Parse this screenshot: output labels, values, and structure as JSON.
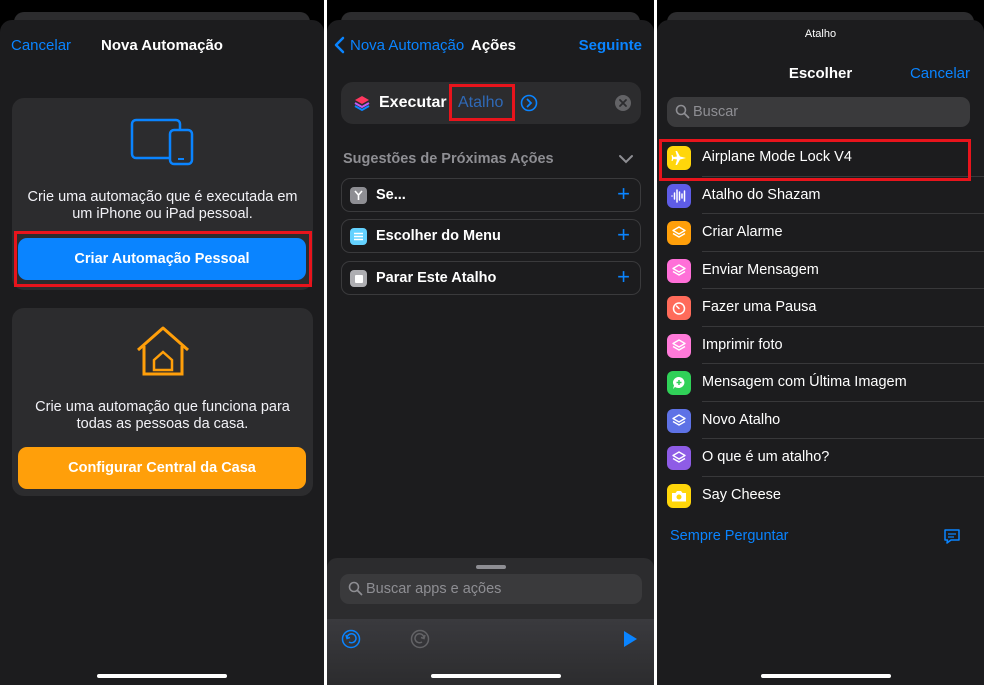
{
  "panel1": {
    "nav": {
      "cancel": "Cancelar",
      "title": "Nova Automação"
    },
    "personal": {
      "description_line1": "Crie uma automação que é executada em",
      "description_line2": "um iPhone ou iPad pessoal.",
      "button": "Criar Automação Pessoal"
    },
    "home": {
      "description_line1": "Crie uma automação que funciona para",
      "description_line2": "todas as pessoas da casa.",
      "button": "Configurar Central da Casa"
    }
  },
  "panel2": {
    "nav": {
      "back": "Nova Automação",
      "title": "Ações",
      "next": "Seguinte"
    },
    "action": {
      "verb": "Executar",
      "param": "Atalho"
    },
    "suggestions_header": "Sugestões de Próximas Ações",
    "suggestions": [
      {
        "label": "Se...",
        "icon": "branch-icon"
      },
      {
        "label": "Escolher do Menu",
        "icon": "menu-icon"
      },
      {
        "label": "Parar Este Atalho",
        "icon": "stop-icon"
      }
    ],
    "search_placeholder": "Buscar apps e ações"
  },
  "panel3": {
    "header_small": "Atalho",
    "title": "Escolher",
    "cancel": "Cancelar",
    "search_placeholder": "Buscar",
    "items": [
      {
        "label": "Airplane Mode Lock V4",
        "color": "#ffd60a",
        "icon": "airplane-icon"
      },
      {
        "label": "Atalho do Shazam",
        "color": "#5e5ce6",
        "icon": "waveform-icon"
      },
      {
        "label": "Criar Alarme",
        "color": "#ff9f0a",
        "icon": "layers-icon"
      },
      {
        "label": "Enviar Mensagem",
        "color": "#ff6fd8",
        "icon": "layers-icon"
      },
      {
        "label": "Fazer uma Pausa",
        "color": "#ff6b5a",
        "icon": "timer-icon"
      },
      {
        "label": "Imprimir foto",
        "color": "#ff7ad9",
        "icon": "layers-icon"
      },
      {
        "label": "Mensagem com Última Imagem",
        "color": "#30d158",
        "icon": "message-icon"
      },
      {
        "label": "Novo Atalho",
        "color": "#5e72e6",
        "icon": "layers-icon"
      },
      {
        "label": "O que é um atalho?",
        "color": "#8e5ce6",
        "icon": "layers-icon"
      },
      {
        "label": "Say Cheese",
        "color": "#ffd60a",
        "icon": "camera-icon"
      }
    ],
    "always_ask": "Sempre Perguntar"
  }
}
